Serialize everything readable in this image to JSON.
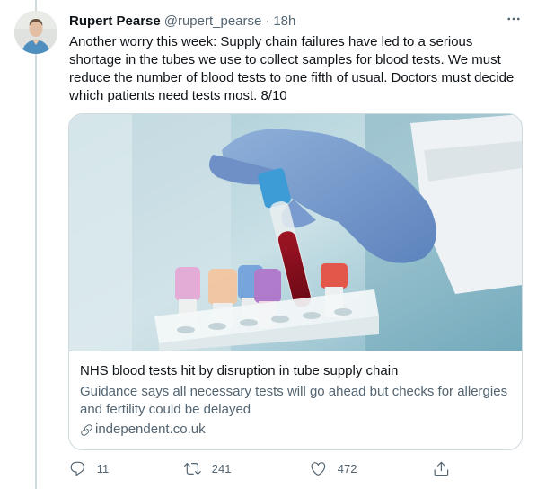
{
  "tweet": {
    "author_name": "Rupert Pearse",
    "handle": "@rupert_pearse",
    "separator": "·",
    "time": "18h",
    "text": "Another worry this week: Supply chain failures have led to a serious shortage in the tubes we use to collect samples for blood tests. We must reduce the number of blood tests to one fifth of usual. Doctors must decide which patients need tests most. 8/10"
  },
  "card": {
    "title": "NHS blood tests hit by disruption in tube supply chain",
    "description": "Guidance says all necessary tests will go ahead but checks for allergies and fertility could be delayed",
    "domain": "independent.co.uk",
    "image_icon": "blood-test-tubes-photo"
  },
  "actions": {
    "reply_count": "11",
    "retweet_count": "241",
    "like_count": "472"
  },
  "colors": {
    "text_primary": "#0f1419",
    "text_secondary": "#536471",
    "border": "#cfd9de",
    "thread_line": "#cfd9de"
  }
}
